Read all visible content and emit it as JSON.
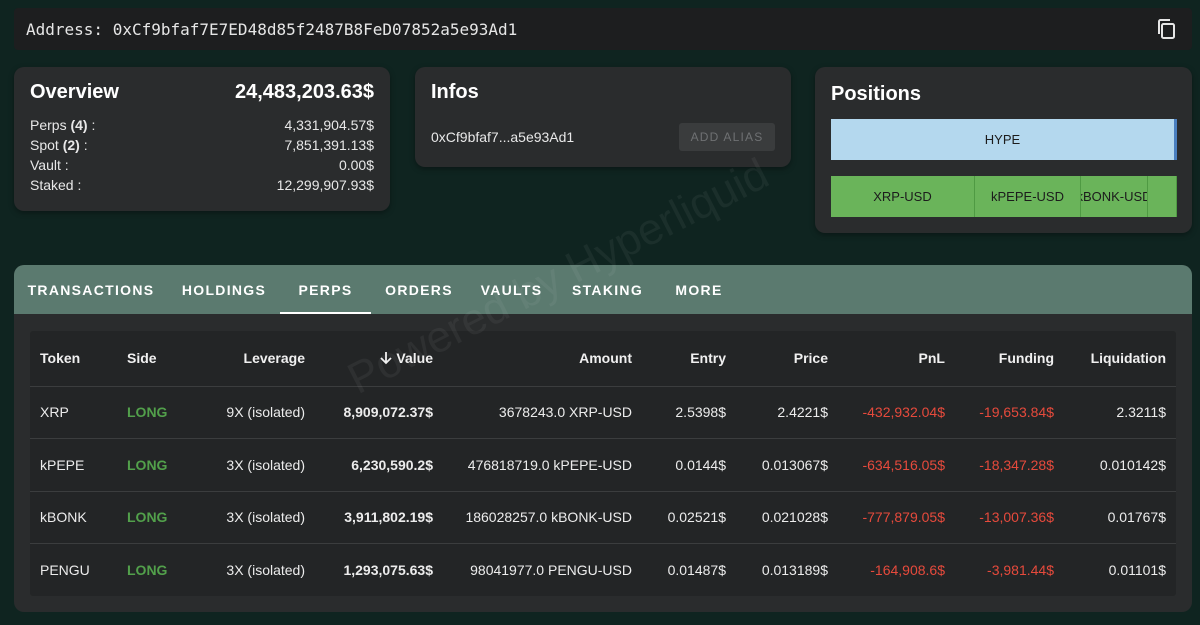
{
  "address_bar": {
    "label": "Address:",
    "address": "0xCf9bfaf7E7ED48d85f2487B8FeD07852a5e93Ad1",
    "copy_icon": "copy-icon"
  },
  "overview": {
    "title": "Overview",
    "total": "24,483,203.63$",
    "rows": [
      {
        "label": "Perps",
        "count": "(4)",
        "suffix": ":",
        "value": "4,331,904.57$"
      },
      {
        "label": "Spot",
        "count": "(2)",
        "suffix": ":",
        "value": "7,851,391.13$"
      },
      {
        "label": "Vault",
        "count": "",
        "suffix": ":",
        "value": "0.00$"
      },
      {
        "label": "Staked",
        "count": "",
        "suffix": ":",
        "value": "12,299,907.93$"
      }
    ]
  },
  "infos": {
    "title": "Infos",
    "address_short": "0xCf9bfaf7...a5e93Ad1",
    "alias_button": "ADD ALIAS"
  },
  "positions": {
    "title": "Positions",
    "spot": [
      {
        "label": "HYPE",
        "color": "#b4d8ee"
      }
    ],
    "perps": [
      {
        "label": "XRP-USD",
        "share": 0.415
      },
      {
        "label": "kPEPE-USD",
        "share": 0.305
      },
      {
        "label": "kBONK-USD",
        "share": 0.195
      },
      {
        "label": "",
        "share": 0.085
      }
    ],
    "perps_color": "#6ab45a"
  },
  "tabs": [
    {
      "label": "TRANSACTIONS",
      "active": false
    },
    {
      "label": "HOLDINGS",
      "active": false
    },
    {
      "label": "PERPS",
      "active": true
    },
    {
      "label": "ORDERS",
      "active": false
    },
    {
      "label": "VAULTS",
      "active": false
    },
    {
      "label": "STAKING",
      "active": false
    },
    {
      "label": "MORE",
      "active": false
    }
  ],
  "table": {
    "columns": [
      "Token",
      "Side",
      "Leverage",
      "Value",
      "Amount",
      "Entry",
      "Price",
      "PnL",
      "Funding",
      "Liquidation"
    ],
    "sort_icon": "arrow-down-icon",
    "rows": [
      {
        "token": "XRP",
        "side": "LONG",
        "leverage": "9X (isolated)",
        "value": "8,909,072.37$",
        "amount": "3678243.0 XRP-USD",
        "entry": "2.5398$",
        "price": "2.4221$",
        "pnl": "-432,932.04$",
        "funding": "-19,653.84$",
        "liquidation": "2.3211$"
      },
      {
        "token": "kPEPE",
        "side": "LONG",
        "leverage": "3X (isolated)",
        "value": "6,230,590.2$",
        "amount": "476818719.0 kPEPE-USD",
        "entry": "0.0144$",
        "price": "0.013067$",
        "pnl": "-634,516.05$",
        "funding": "-18,347.28$",
        "liquidation": "0.010142$"
      },
      {
        "token": "kBONK",
        "side": "LONG",
        "leverage": "3X (isolated)",
        "value": "3,911,802.19$",
        "amount": "186028257.0 kBONK-USD",
        "entry": "0.02521$",
        "price": "0.021028$",
        "pnl": "-777,879.05$",
        "funding": "-13,007.36$",
        "liquidation": "0.01767$"
      },
      {
        "token": "PENGU",
        "side": "LONG",
        "leverage": "3X (isolated)",
        "value": "1,293,075.63$",
        "amount": "98041977.0 PENGU-USD",
        "entry": "0.01487$",
        "price": "0.013189$",
        "pnl": "-164,908.6$",
        "funding": "-3,981.44$",
        "liquidation": "0.01101$"
      }
    ]
  },
  "watermark": "Powered by Hyperliquid",
  "colors": {
    "background": "#0f2420",
    "card": "#2a2c2d",
    "tabs_bar": "#5b7a6f",
    "long": "#52a04b",
    "negative": "#e64a3c"
  }
}
